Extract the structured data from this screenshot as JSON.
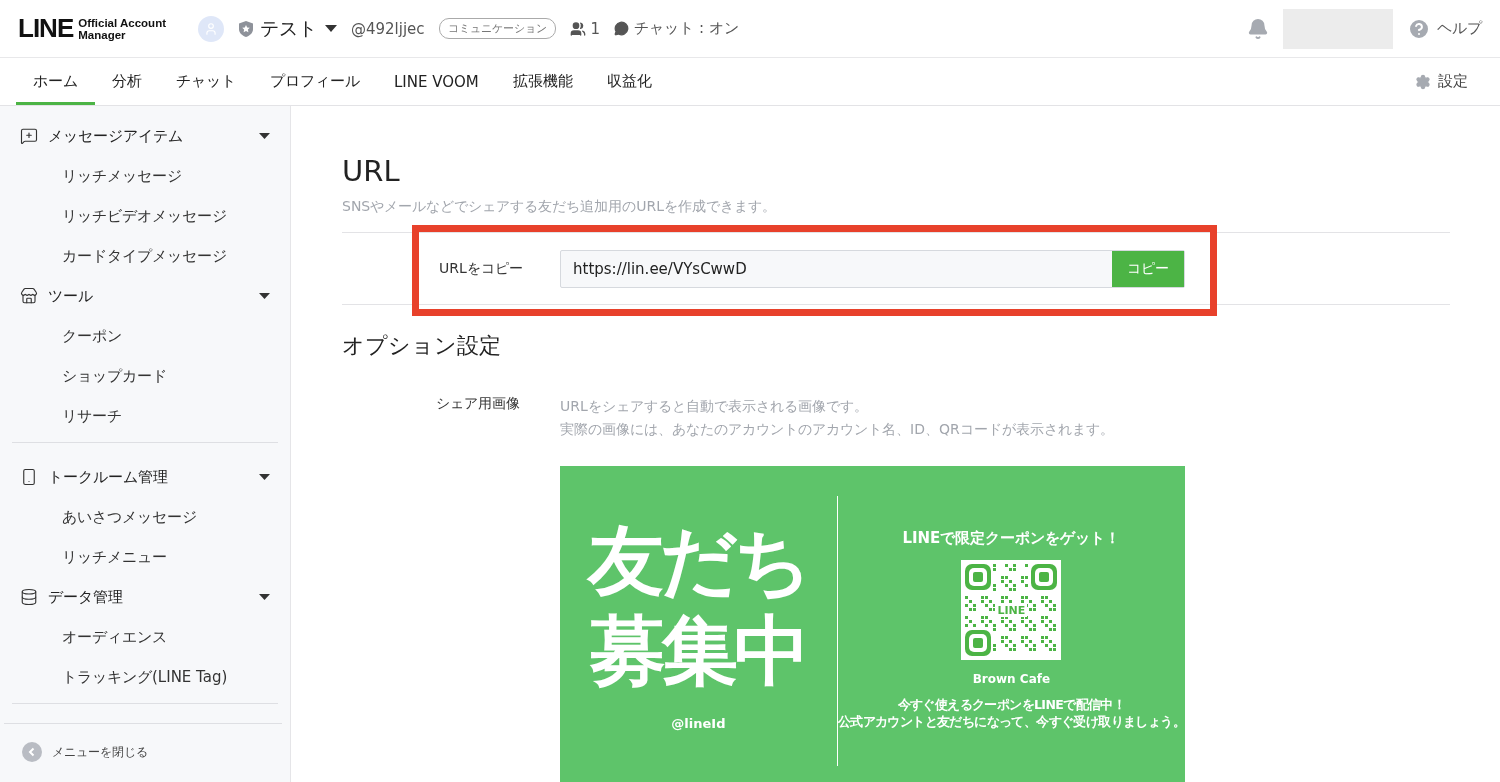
{
  "header": {
    "logo": "LINE",
    "logo_sub": [
      "Official Account",
      "Manager"
    ],
    "account_name": "テスト",
    "account_id": "@492ljjec",
    "plan_badge": "コミュニケーション",
    "friends": "1",
    "chat_status": "チャット : オン",
    "help": "ヘルプ"
  },
  "tabs": [
    {
      "label": "ホーム",
      "selected": true
    },
    {
      "label": "分析",
      "selected": false
    },
    {
      "label": "チャット",
      "selected": false
    },
    {
      "label": "プロフィール",
      "selected": false
    },
    {
      "label": "LINE VOOM",
      "selected": false
    },
    {
      "label": "拡張機能",
      "selected": false
    },
    {
      "label": "収益化",
      "selected": false
    }
  ],
  "settings": "設定",
  "sidebar": {
    "sections": [
      [
        {
          "kind": "message",
          "label": "メッセージアイテム",
          "expanded": true,
          "children": [
            "リッチメッセージ",
            "リッチビデオメッセージ",
            "カードタイプメッセージ"
          ]
        },
        {
          "kind": "tool",
          "label": "ツール",
          "expanded": true,
          "children": [
            "クーポン",
            "ショップカード",
            "リサーチ"
          ]
        }
      ],
      [
        {
          "kind": "chatroom",
          "label": "トークルーム管理",
          "expanded": true,
          "children": [
            "あいさつメッセージ",
            "リッチメニュー"
          ]
        },
        {
          "kind": "data",
          "label": "データ管理",
          "expanded": true,
          "children": [
            "オーディエンス",
            "トラッキング(LINE Tag)"
          ]
        }
      ]
    ],
    "close_menu": "メニューを閉じる"
  },
  "main": {
    "title": "URL",
    "description": "SNSやメールなどでシェアする友だち追加用のURLを作成できます。",
    "url_row": {
      "label": "URLをコピー",
      "value": "https://lin.ee/VYsCwwD",
      "button": "コピー",
      "highlighted": true
    },
    "options_title": "オプション設定",
    "share_image": {
      "label": "シェア用画像",
      "notes": [
        "URLをシェアすると自動で表示される画像です。",
        "実際の画像には、あなたのアカウントのアカウント名、ID、QRコードが表示されます。"
      ],
      "preview": {
        "headline": [
          "友だち",
          "募集中"
        ],
        "line_id": "@lineId",
        "promo": "LINEで限定クーポンをゲット！",
        "qr_label": "LINE",
        "shop": "Brown Cafe",
        "body": [
          "今すぐ使えるクーポンをLINEで配信中！",
          "公式アカウントと友だちになって、今すぐ受け取りましょう。"
        ]
      }
    }
  }
}
